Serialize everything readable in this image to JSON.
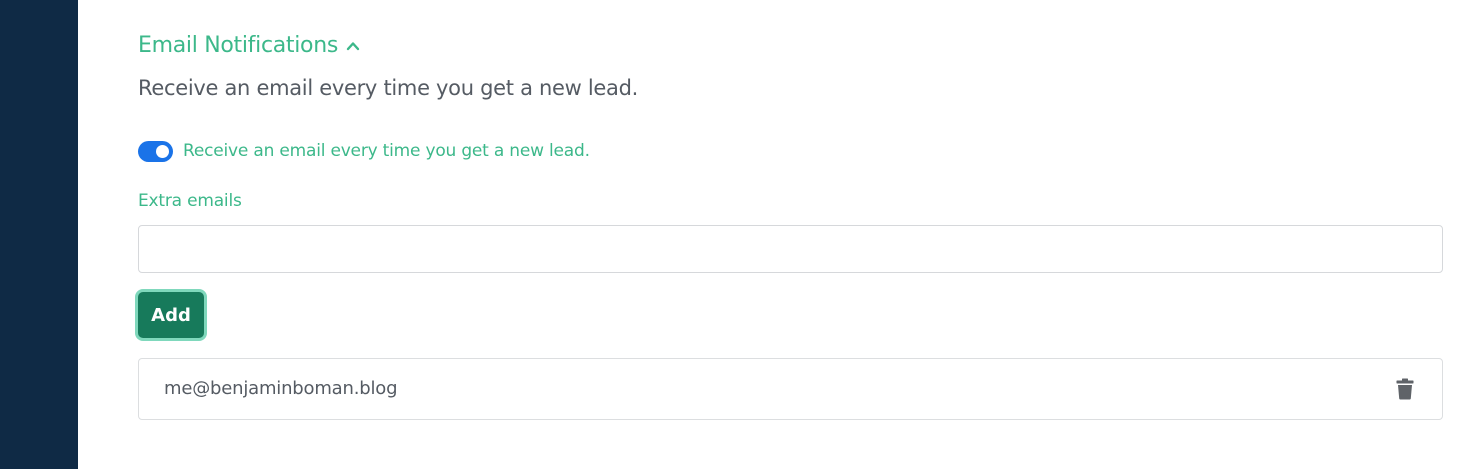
{
  "section": {
    "title": "Email Notifications",
    "icon": "chevron-up-icon",
    "description": "Receive an email every time you get a new lead."
  },
  "toggle": {
    "label": "Receive an email every time you get a new lead.",
    "enabled": true
  },
  "extra_emails": {
    "label": "Extra emails",
    "value": "",
    "placeholder": "",
    "add_label": "Add"
  },
  "emails": [
    {
      "address": "me@benjaminboman.blog",
      "delete_icon": "trash-icon"
    }
  ],
  "colors": {
    "sidebar": "#0f2a45",
    "accent_green": "#3cb88a",
    "button_green": "#177a5b",
    "toggle_blue": "#1a73e8",
    "text_gray": "#555b63"
  }
}
